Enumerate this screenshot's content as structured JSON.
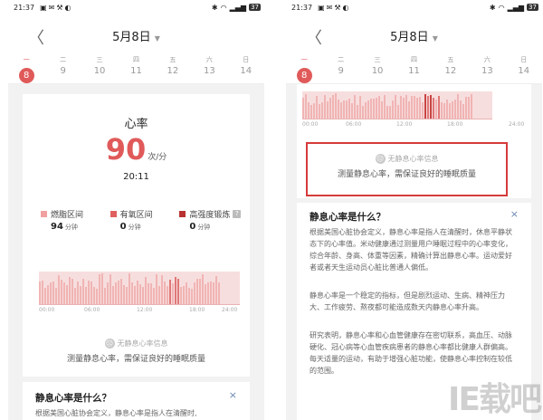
{
  "status_bar": {
    "time": "21:37",
    "battery": "37"
  },
  "header": {
    "date": "5月8日",
    "back_glyph": "〈"
  },
  "week": [
    {
      "wd": "一",
      "day": "8"
    },
    {
      "wd": "二",
      "day": "9"
    },
    {
      "wd": "三",
      "day": "10"
    },
    {
      "wd": "四",
      "day": "11"
    },
    {
      "wd": "五",
      "day": "12"
    },
    {
      "wd": "六",
      "day": "13"
    },
    {
      "wd": "日",
      "day": "14"
    }
  ],
  "heart_rate": {
    "title": "心率",
    "value": "90",
    "unit": "次/分",
    "time": "20:11"
  },
  "zones": [
    {
      "label": "燃脂区间",
      "value": "94",
      "unit": "分钟",
      "color": "#f1a0a0"
    },
    {
      "label": "有氧区间",
      "value": "0",
      "unit": "分钟",
      "color": "#e06060"
    },
    {
      "label": "高强度锻炼",
      "value": "0",
      "unit": "分钟",
      "color": "#b83232"
    }
  ],
  "chart_axis": [
    "00:00",
    "06:00",
    "12:00",
    "18:00",
    "24:00"
  ],
  "resting": {
    "no_info": "无静息心率信息",
    "desc": "测量静息心率，需保证良好的睡眠质量"
  },
  "question": {
    "title": "静息心率是什么？",
    "close": "×",
    "p1_left": "根据美国心脏协会定义，静息心率是指人在清醒时,",
    "p1": "根据美国心脏协会定义，静息心率是指人在清醒时，休息平静状态下的心率值。米动健康通过测量用户睡眠过程中的心率变化，综合年龄、身高、体重等因素，精确计算出静息心率。运动爱好者或者天生运动员心脏比普通人偏低。",
    "p2": "静息心率是一个稳定的指标，但是剧烈运动、生病、精神压力大、工作疲劳、熬夜都可能造成数天内静息心率升高。",
    "p3": "研究表明，静息心率和心血管健康存在密切联系，高血压、动脉硬化、冠心病等心血管疾病患者的静息心率都比健康人群偏高。每天适量的运动，有助于增强心脏功能，使静息心率控制在较低的范围。"
  },
  "watermark": "IE载吧"
}
